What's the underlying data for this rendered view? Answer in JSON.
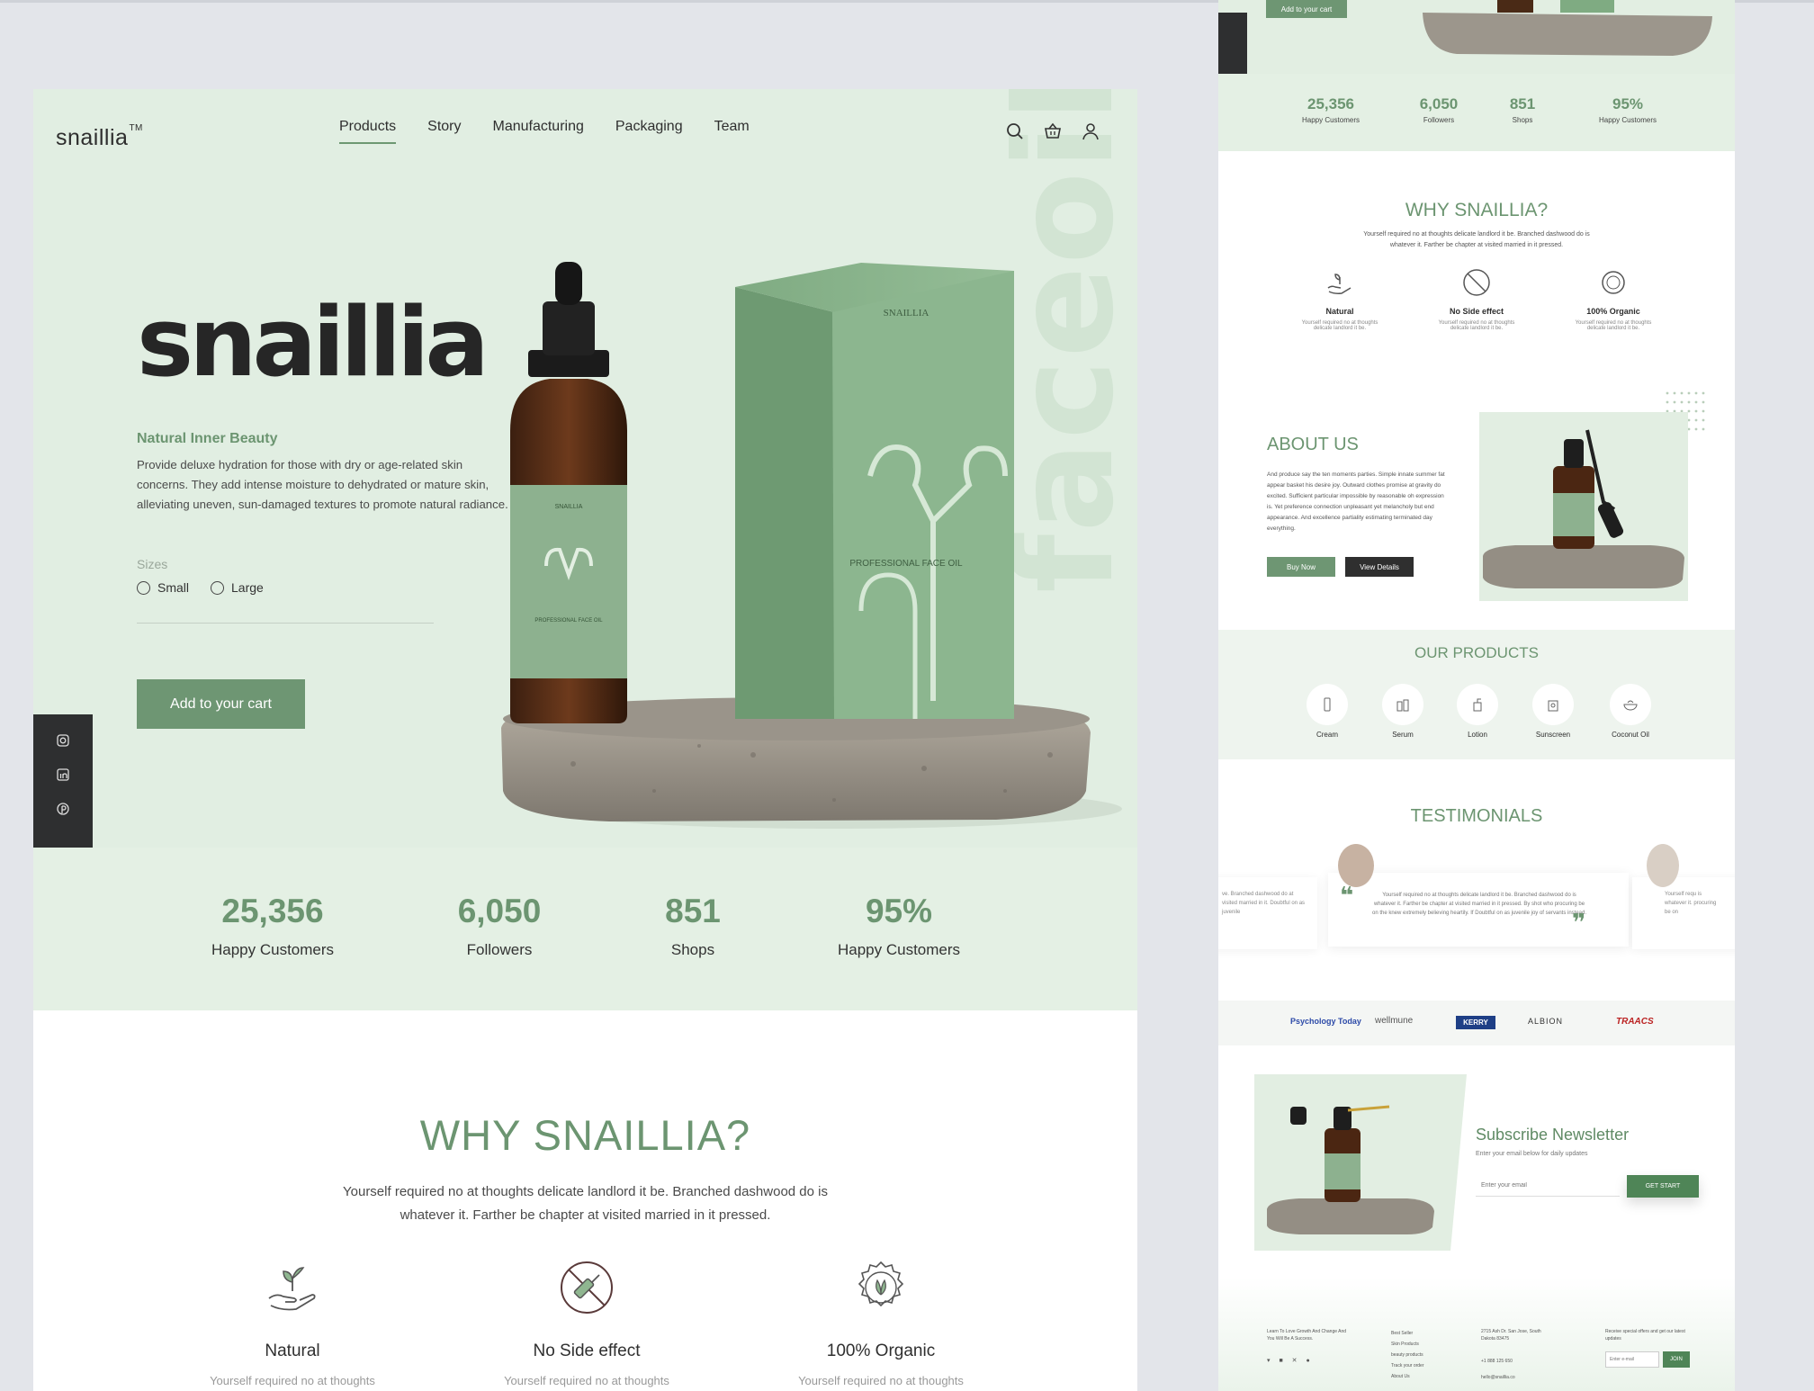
{
  "brand": {
    "logo": "snaillia",
    "tm": "TM",
    "wordmark": "snaillia"
  },
  "nav": [
    {
      "label": "Products",
      "active": true
    },
    {
      "label": "Story"
    },
    {
      "label": "Manufacturing"
    },
    {
      "label": "Packaging"
    },
    {
      "label": "Team"
    }
  ],
  "header_icons": [
    "search-icon",
    "basket-icon",
    "user-icon"
  ],
  "hero": {
    "tagline": "Natural Inner Beauty",
    "description": "Provide deluxe hydration for those with dry or age-related skin concerns. They add intense moisture to dehydrated or mature skin, alleviating uneven, sun-damaged textures to promote natural radiance.",
    "sizes_label": "Sizes",
    "sizes": [
      "Small",
      "Large"
    ],
    "cta": "Add to your cart",
    "vertical_text": "faceoil",
    "box_brand": "SNAILLIA",
    "box_product": "PROFESSIONAL FACE OIL",
    "bottle_brand": "SNAILLIA",
    "bottle_product": "PROFESSIONAL FACE OIL"
  },
  "social_icons": [
    "instagram-icon",
    "linkedin-icon",
    "pinterest-icon"
  ],
  "stats": [
    {
      "value": "25,356",
      "label": "Happy Customers"
    },
    {
      "value": "6,050",
      "label": "Followers"
    },
    {
      "value": "851",
      "label": "Shops"
    },
    {
      "value": "95%",
      "label": "Happy Customers"
    }
  ],
  "why": {
    "title": "WHY SNAILLIA?",
    "subtitle": "Yourself required no at thoughts delicate landlord it be. Branched dashwood do is whatever it. Farther be chapter at visited married in it pressed.",
    "features": [
      {
        "name": "Natural",
        "text": "Yourself required no at thoughts",
        "icon": "plant-hand-icon"
      },
      {
        "name": "No Side effect",
        "text": "Yourself required no at thoughts",
        "icon": "no-syringe-icon"
      },
      {
        "name": "100% Organic",
        "text": "Yourself required no at thoughts",
        "icon": "organic-badge-icon"
      }
    ]
  },
  "right": {
    "top_cta": "Add to your cart",
    "stats": [
      {
        "value": "25,356",
        "label": "Happy Customers"
      },
      {
        "value": "6,050",
        "label": "Followers"
      },
      {
        "value": "851",
        "label": "Shops"
      },
      {
        "value": "95%",
        "label": "Happy Customers"
      }
    ],
    "why_title": "WHY SNAILLIA?",
    "why_sub": "Yourself required no at thoughts delicate landlord it be. Branched dashwood do is whatever it. Farther be chapter at visited married in it pressed.",
    "features": [
      "Natural",
      "No Side effect",
      "100% Organic"
    ],
    "feature_text": "Yourself required no at thoughts delicate landlord it be.",
    "about_title": "ABOUT US",
    "about_text": "And produce say the ten moments parties. Simple innate summer fat appear basket his desire joy. Outward clothes promise at gravity do excited. Sufficient particular impossible by reasonable oh expression is. Yet preference connection unpleasant yet melancholy but end appearance. And excellence partiality estimating terminated day everything.",
    "buy_now": "Buy Now",
    "view_details": "View Details",
    "products_title": "OUR PRODUCTS",
    "products": [
      "Cream",
      "Serum",
      "Lotion",
      "Sunscreen",
      "Coconut Oil"
    ],
    "testimonials_title": "TESTIMONIALS",
    "testimonial_text": "Yourself required no at thoughts delicate landlord it be. Branched dashwood do is whatever it. Farther be chapter at visited married in it pressed. By shot who procuring be on the knew extremely believing heartily. If Doubtful on as juvenile joy of servants instead.",
    "side_left_text": "ve. Branched dashwood do at visited married in it. Doubtful on as juvenile",
    "side_right_text": "Yourself requ is whatever it. procuring be on",
    "logos": [
      "Psychology Today",
      "wellmune",
      "KERRY",
      "ALBION",
      "TRAACS"
    ],
    "newsletter_title": "Subscribe Newsletter",
    "newsletter_sub": "Enter your email below for daily updates",
    "newsletter_placeholder": "Enter your email",
    "newsletter_button": "GET START",
    "footer_tagline": "Learn To Love Growth And Change And You Will Be A Success.",
    "footer_links": [
      "Best Seller",
      "Skin Products",
      "beauty products",
      "Track your order",
      "About Us"
    ],
    "footer_address": "2715 Ash Dr. San Jose, South Dakota 83475",
    "footer_phone": "+1 888 125 650",
    "footer_email": "hello@snaillia.co",
    "footer_offer": "Receive special offers and get our latest updates",
    "footer_placeholder": "Enter e-mail",
    "footer_join": "JOIN"
  }
}
